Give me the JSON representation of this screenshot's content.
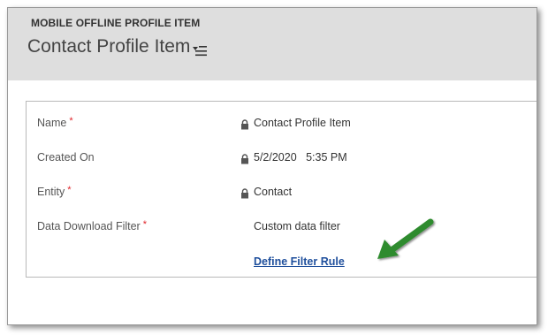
{
  "header": {
    "entity_label": "MOBILE OFFLINE PROFILE ITEM",
    "record_title": "Contact Profile Item",
    "form_selector_icon": "form-selector-icon"
  },
  "form": {
    "fields": [
      {
        "label": "Name",
        "required": "*",
        "value": "Contact Profile Item",
        "locked": true
      },
      {
        "label": "Created On",
        "required": "",
        "value": "5/2/2020   5:35 PM",
        "locked": true
      },
      {
        "label": "Entity",
        "required": "*",
        "value": "Contact",
        "locked": true
      },
      {
        "label": "Data Download Filter",
        "required": "*",
        "value": "Custom data filter",
        "locked": false
      }
    ],
    "filter_link": "Define Filter Rule"
  },
  "colors": {
    "header_bg": "#dedede",
    "required": "#e0242a",
    "link": "#1f4f9c",
    "arrow": "#2e8b2e"
  },
  "icons": [
    "lock-icon",
    "form-selector-icon",
    "green-arrow-annotation"
  ]
}
